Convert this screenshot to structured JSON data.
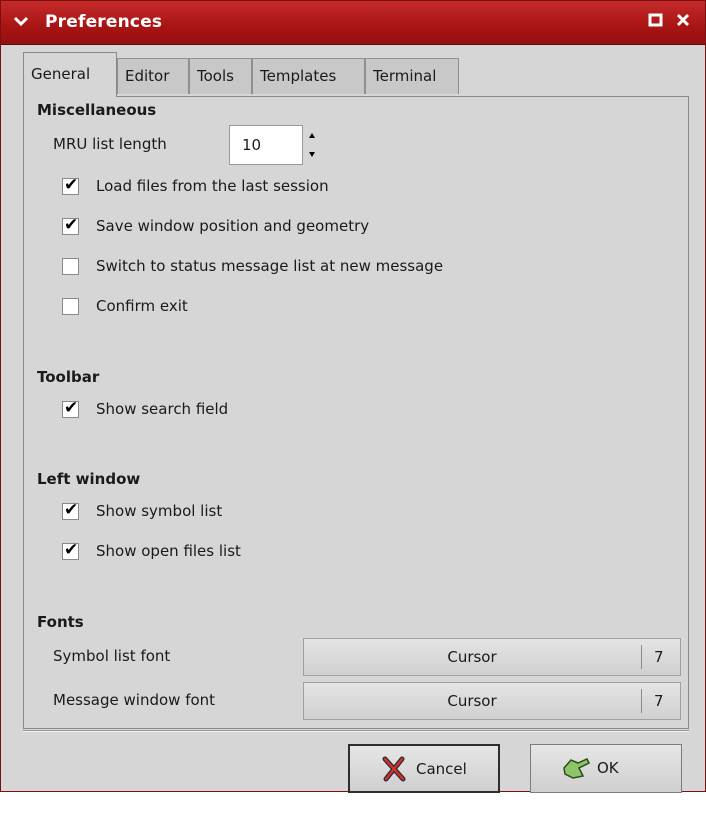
{
  "titlebar": {
    "title": "Preferences",
    "menu_icon": "chevron-down-icon",
    "maximize_icon": "square-icon",
    "close_icon": "x-icon"
  },
  "tabs": [
    {
      "label": "General",
      "active": true
    },
    {
      "label": "Editor"
    },
    {
      "label": "Tools"
    },
    {
      "label": "Templates"
    },
    {
      "label": "Terminal"
    }
  ],
  "misc": {
    "heading": "Miscellaneous",
    "mru_label": "MRU list length",
    "mru_value": "10",
    "checks": [
      {
        "label": "Load files from the last session",
        "checked": true
      },
      {
        "label": "Save window position and geometry",
        "checked": true
      },
      {
        "label": "Switch to status message list at new message",
        "checked": false
      },
      {
        "label": "Confirm exit",
        "checked": false
      }
    ]
  },
  "toolbar": {
    "heading": "Toolbar",
    "checks": [
      {
        "label": "Show search field",
        "checked": true
      }
    ]
  },
  "left_window": {
    "heading": "Left window",
    "checks": [
      {
        "label": "Show symbol list",
        "checked": true
      },
      {
        "label": "Show open files list",
        "checked": true
      }
    ]
  },
  "fonts": {
    "heading": "Fonts",
    "symbol_list": {
      "label": "Symbol list font",
      "name": "Cursor",
      "size": "7"
    },
    "message_window": {
      "label": "Message window font",
      "name": "Cursor",
      "size": "7"
    }
  },
  "buttons": {
    "cancel": "Cancel",
    "ok": "OK",
    "cancel_icon": "cancel-x-icon",
    "ok_icon": "ok-hand-icon"
  },
  "colors": {
    "title_red": "#b21a1a",
    "panel": "#d6d6d6"
  }
}
